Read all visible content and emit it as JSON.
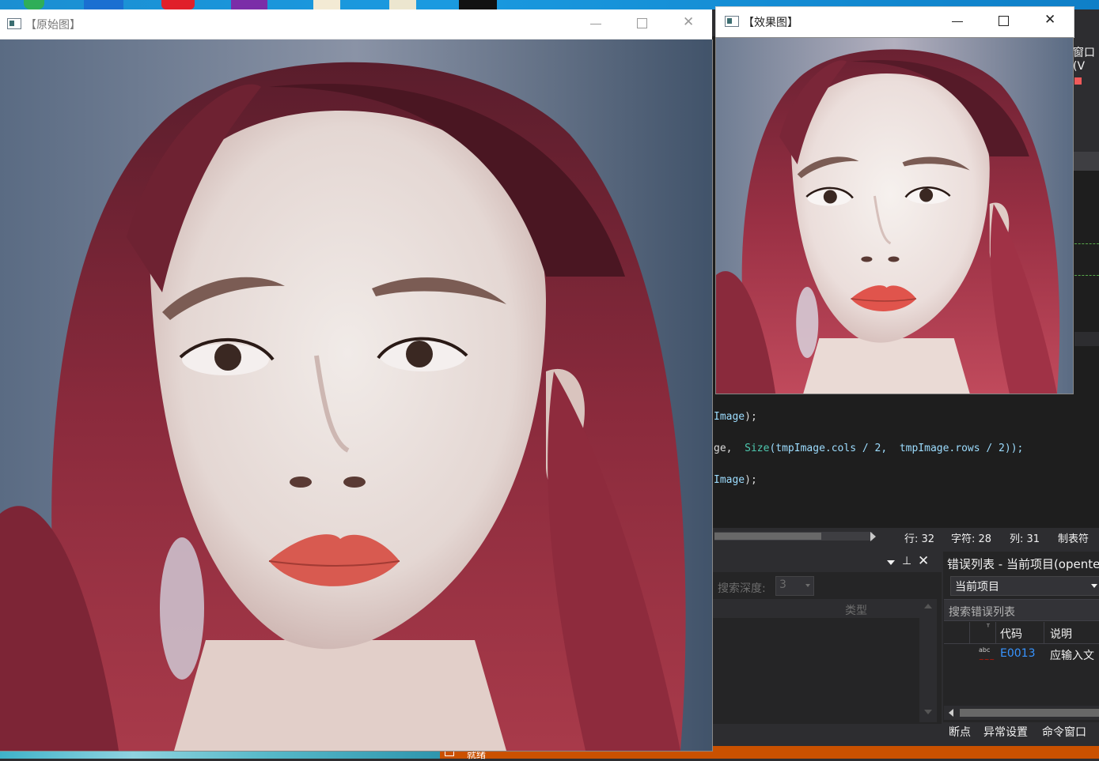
{
  "windows": {
    "original": {
      "title": "【原始图】"
    },
    "result": {
      "title": "【效果图】"
    }
  },
  "editor": {
    "lines": [
      {
        "text_a": "Image",
        "text_b": ");"
      },
      {
        "text_a": "ge,  ",
        "fn": "Size",
        "text_b": "(tmpImage.cols / 2,  tmpImage.rows / 2));"
      },
      {
        "text_a": "Image",
        "text_b": ");"
      }
    ],
    "side_fragment": "窗口(V"
  },
  "status": {
    "line": "行: 32",
    "char": "字符: 28",
    "col": "列: 31",
    "mode": "制表符"
  },
  "find_panel": {
    "search_depth_label": "搜索深度:",
    "search_depth_value": "3",
    "column_type": "类型"
  },
  "error_list": {
    "title": "错误列表 - 当前项目(opente",
    "scope_value": "当前项目",
    "search_placeholder": "搜索错误列表",
    "col_code": "代码",
    "col_desc": "说明",
    "rows": [
      {
        "code": "E0013",
        "desc": "应输入文"
      }
    ]
  },
  "bottom_tabs": [
    "断点",
    "异常设置",
    "命令窗口"
  ],
  "status_ready": "就绪",
  "colors": {
    "vs_bg": "#1e1e1e",
    "vs_panel": "#252526",
    "accent_orange": "#ca5100",
    "link_blue": "#3794ff"
  }
}
